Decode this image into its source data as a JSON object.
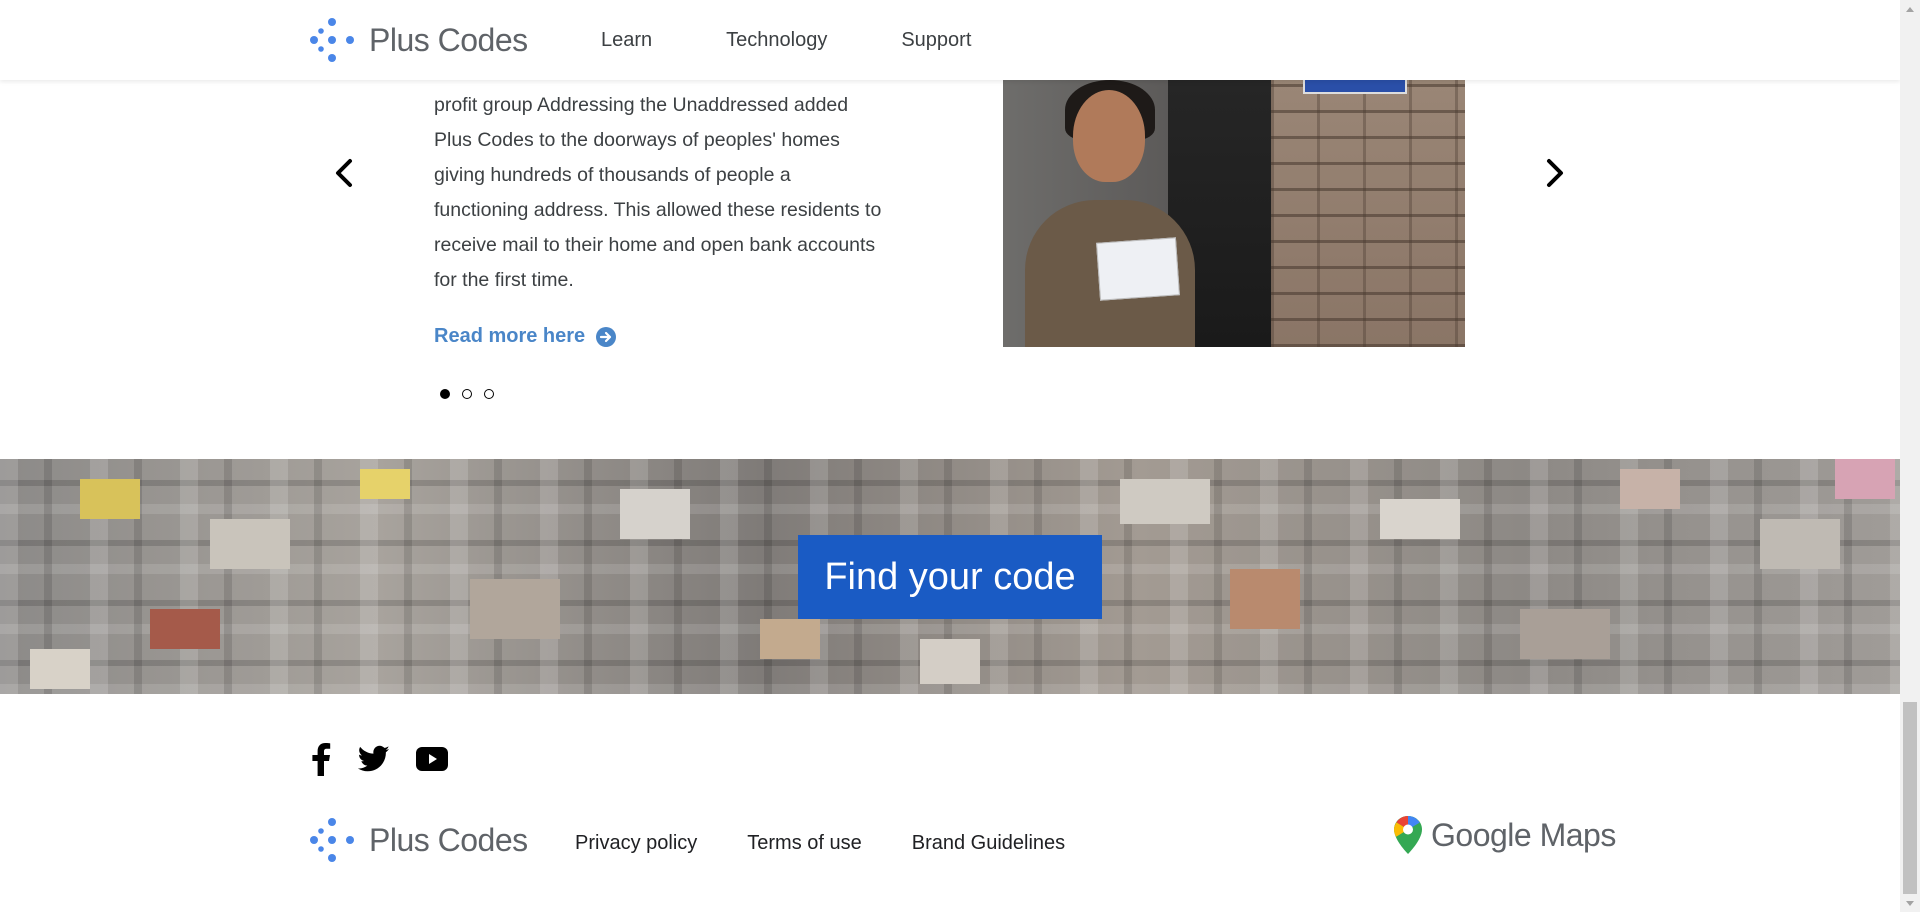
{
  "header": {
    "logo_text": "Plus Codes",
    "nav": [
      {
        "label": "Learn"
      },
      {
        "label": "Technology"
      },
      {
        "label": "Support"
      }
    ]
  },
  "carousel": {
    "text": "profit group Addressing the Unaddressed added Plus Codes to the doorways of peoples' homes giving hundreds of thousands of people a functioning address. This allowed these residents to receive mail to their home and open bank accounts for the first time.",
    "read_more": "Read more here",
    "slide_count": 3,
    "active_slide": 1
  },
  "banner": {
    "cta": "Find your code"
  },
  "footer": {
    "logo_text": "Plus Codes",
    "links": [
      {
        "label": "Privacy policy"
      },
      {
        "label": "Terms of use"
      },
      {
        "label": "Brand Guidelines"
      }
    ],
    "maps_text": "Google Maps",
    "social": [
      "facebook-icon",
      "twitter-icon",
      "youtube-icon"
    ]
  },
  "colors": {
    "accent_blue": "#1a5bc4",
    "link_blue": "#4a86c8",
    "logo_dot_blue": "#4a86e8"
  }
}
